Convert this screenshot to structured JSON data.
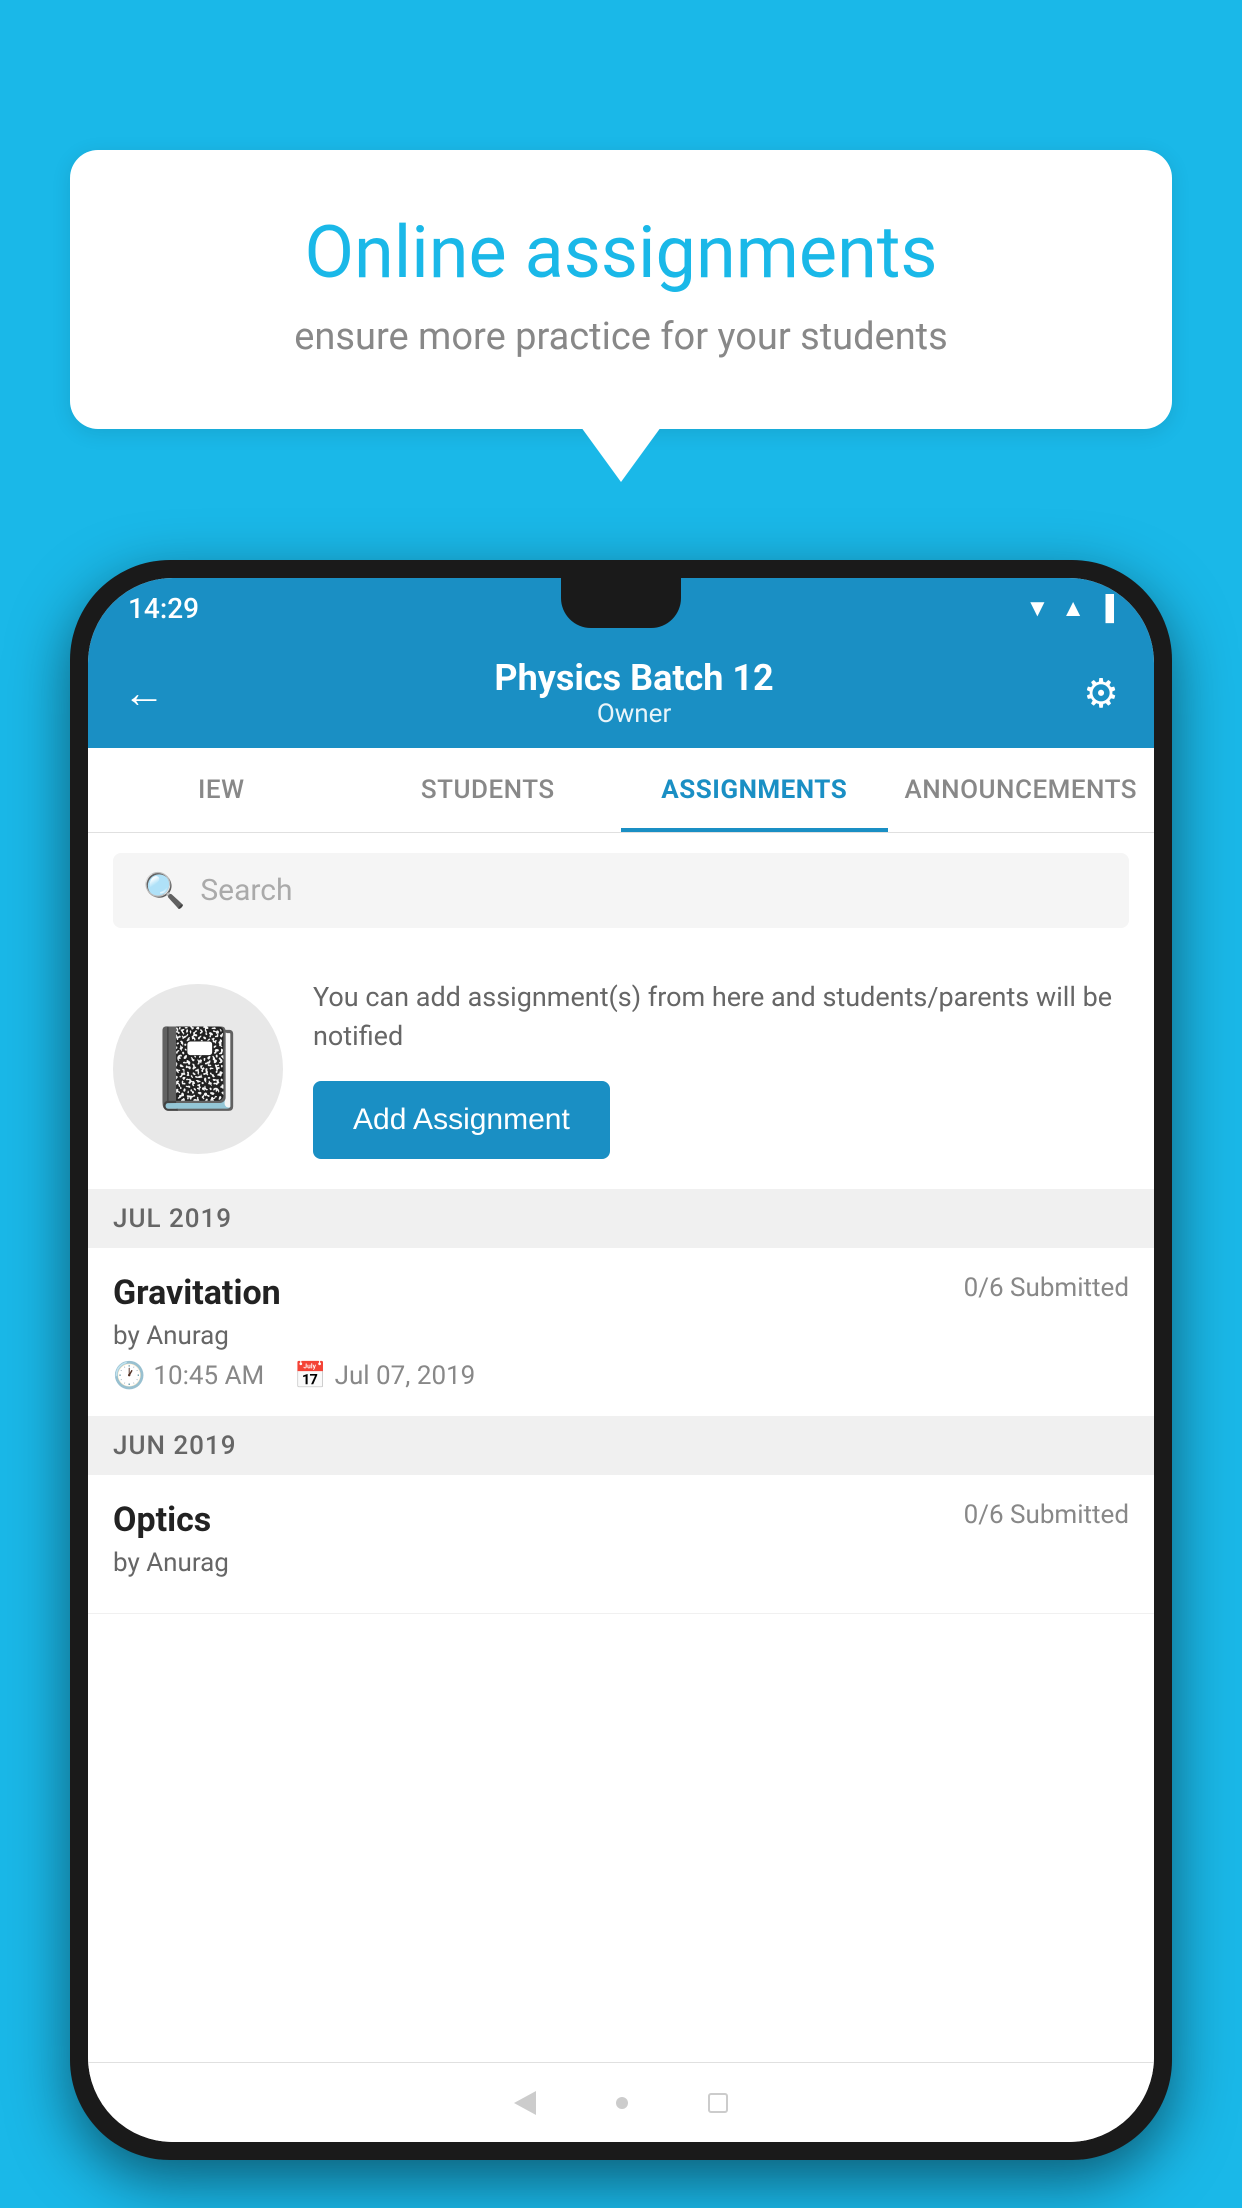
{
  "background": {
    "color": "#1ab8e8"
  },
  "speech_bubble": {
    "title": "Online assignments",
    "subtitle": "ensure more practice for your students"
  },
  "status_bar": {
    "time": "14:29",
    "wifi_icon": "▲",
    "signal_icon": "▲",
    "battery_icon": "▐"
  },
  "app_bar": {
    "title": "Physics Batch 12",
    "subtitle": "Owner",
    "back_label": "←",
    "settings_label": "⚙"
  },
  "tabs": [
    {
      "label": "IEW",
      "active": false
    },
    {
      "label": "STUDENTS",
      "active": false
    },
    {
      "label": "ASSIGNMENTS",
      "active": true
    },
    {
      "label": "ANNOUNCEMENTS",
      "active": false
    }
  ],
  "search": {
    "placeholder": "Search"
  },
  "add_assignment": {
    "description": "You can add assignment(s) from here and students/parents will be notified",
    "button_label": "Add Assignment"
  },
  "sections": [
    {
      "header": "JUL 2019",
      "assignments": [
        {
          "name": "Gravitation",
          "submitted": "0/6 Submitted",
          "by": "by Anurag",
          "time": "10:45 AM",
          "date": "Jul 07, 2019"
        }
      ]
    },
    {
      "header": "JUN 2019",
      "assignments": [
        {
          "name": "Optics",
          "submitted": "0/6 Submitted",
          "by": "by Anurag",
          "time": "",
          "date": ""
        }
      ]
    }
  ]
}
